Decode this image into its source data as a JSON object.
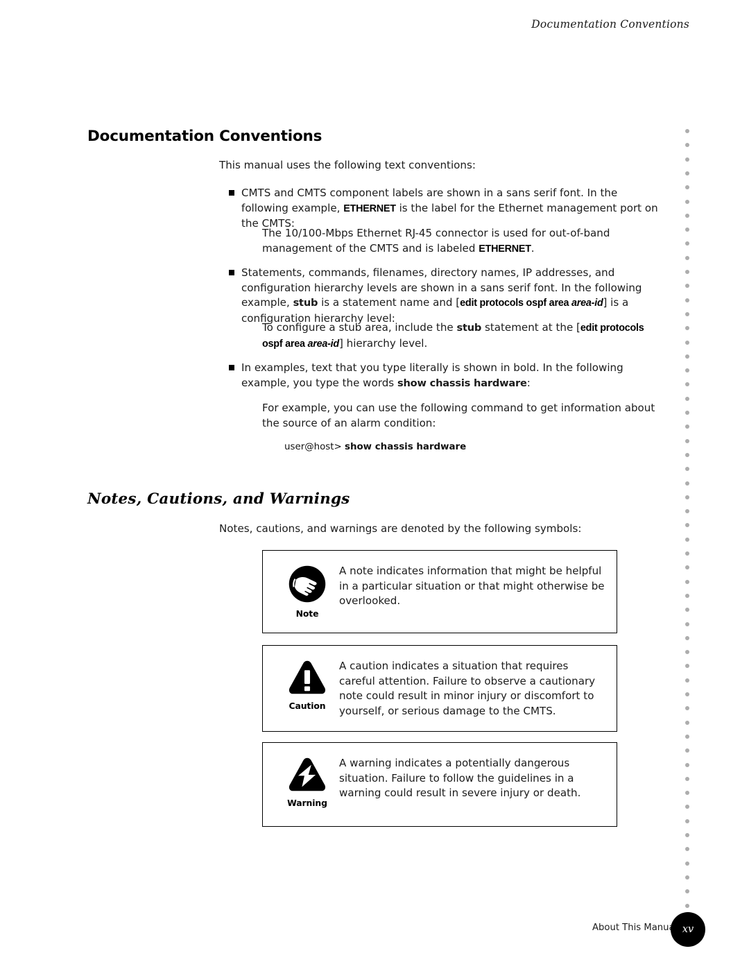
{
  "running_head": "Documentation Conventions",
  "sections": {
    "doc_conventions": {
      "title": "Documentation Conventions",
      "intro": "This manual uses the following text conventions:",
      "bullets": [
        {
          "part1": "CMTS and CMTS component labels are shown in a sans serif font. In the following example, ",
          "token1": "ETHERNET",
          "part2": " is the label for the Ethernet management port on the CMTS:",
          "nested": {
            "part1": "The 10/100-Mbps Ethernet RJ-45 connector is used for out-of-band management of the CMTS and is labeled ",
            "token1": "ETHERNET",
            "part2": "."
          }
        },
        {
          "part1": "Statements, commands, filenames, directory names, IP addresses, and configuration hierarchy levels are shown in a sans serif font. In the following example, ",
          "token1": "stub",
          "part2": " is a statement name and [",
          "token2": "edit protocols ospf area ",
          "token2_italic": "area-id",
          "part3": "] is a configuration hierarchy level:",
          "nested": {
            "part1": "To configure a stub area, include the ",
            "token1": "stub",
            "part2": " statement at the [",
            "token2": "edit protocols ospf area ",
            "token2_italic": "area-id",
            "part3": "] hierarchy level."
          }
        },
        {
          "part1": "In examples, text that you type literally is shown in bold. In the following example, you type the words ",
          "token1": "show chassis hardware",
          "part2": ":",
          "nested": {
            "part1": "For example, you can use the following command to get information about the source of an alarm condition:"
          },
          "code": {
            "prompt": "user@host> ",
            "command": "show chassis hardware"
          }
        }
      ]
    },
    "notes_cautions_warnings": {
      "title": "Notes, Cautions, and Warnings",
      "intro": "Notes, cautions, and warnings are denoted by the following symbols:",
      "boxes": [
        {
          "icon": "note-hand-icon",
          "label": "Note",
          "text": "A note indicates information that might be helpful in a particular situation or that might otherwise be overlooked."
        },
        {
          "icon": "caution-exclamation-triangle-icon",
          "label": "Caution",
          "text": "A caution indicates a situation that requires careful attention. Failure to observe a cautionary note could result in minor injury or discomfort to yourself, or serious damage to the CMTS."
        },
        {
          "icon": "warning-lightning-triangle-icon",
          "label": "Warning",
          "text": "A warning indicates a potentially dangerous situation. Failure to follow the guidelines in a warning could result in severe injury or death."
        }
      ]
    }
  },
  "footer": {
    "label": "About This Manual",
    "page_number": "xv"
  },
  "colors": {
    "text": "#1c1c1c",
    "rule": "#000000",
    "dot_rail": "#adadad",
    "badge_bg": "#000000"
  }
}
